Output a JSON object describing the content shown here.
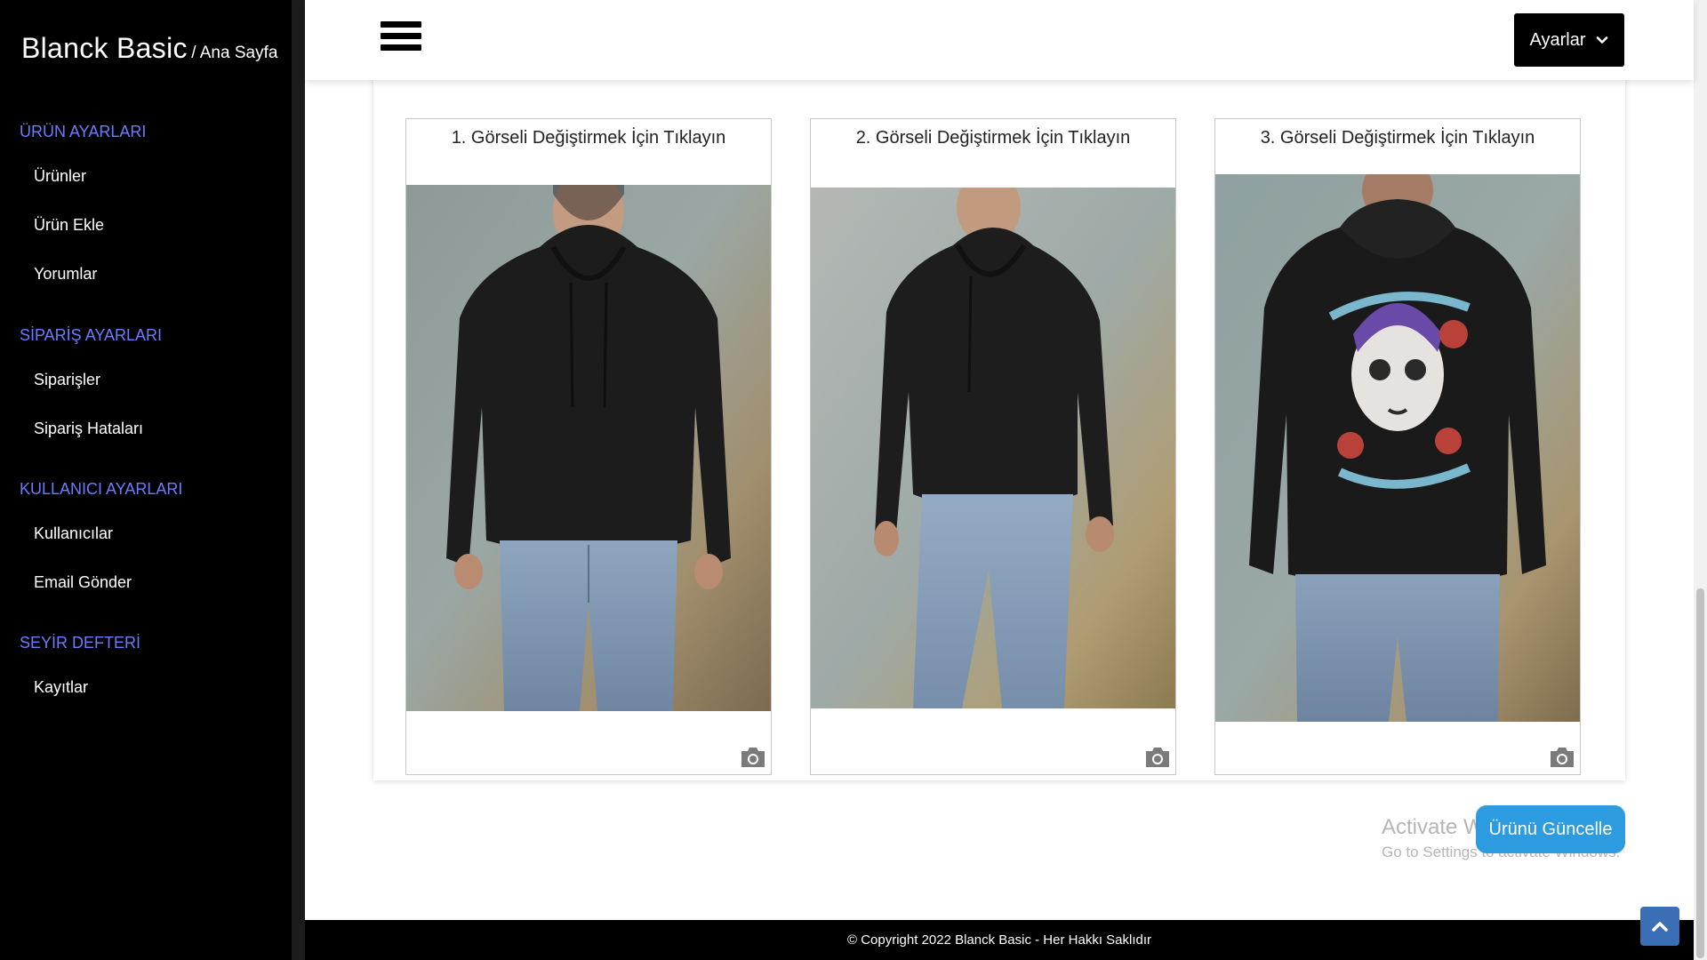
{
  "brand": {
    "name": "Blanck Basic",
    "crumb": "/ Ana Sayfa"
  },
  "nav": {
    "sections": [
      {
        "title": "ÜRÜN AYARLARI",
        "items": [
          "Ürünler",
          "Ürün Ekle",
          "Yorumlar"
        ]
      },
      {
        "title": "SİPARİŞ AYARLARI",
        "items": [
          "Siparişler",
          "Sipariş Hataları"
        ]
      },
      {
        "title": "KULLANICI AYARLARI",
        "items": [
          "Kullanıcılar",
          "Email Gönder"
        ]
      },
      {
        "title": "SEYİR DEFTERİ",
        "items": [
          "Kayıtlar"
        ]
      }
    ]
  },
  "header": {
    "settings_label": "Ayarlar"
  },
  "images": [
    {
      "title": "1. Görseli Değiştirmek İçin Tıklayın",
      "view": "front"
    },
    {
      "title": "2. Görseli Değiştirmek İçin Tıklayın",
      "view": "side"
    },
    {
      "title": "3. Görseli Değiştirmek İçin Tıklayın",
      "view": "back-print"
    }
  ],
  "actions": {
    "update_label": "Ürünü Güncelle"
  },
  "watermark": {
    "line1": "Activate Windows",
    "line2": "Go to Settings to activate Windows."
  },
  "footer": {
    "copyright": "© Copyright 2022 Blanck Basic - Her Hakkı Saklıdır"
  },
  "colors": {
    "sidebar_bg": "#000000",
    "section_title": "#6b7dff",
    "update_button": "#2d9bdf",
    "to_top": "#3b6fb5"
  }
}
